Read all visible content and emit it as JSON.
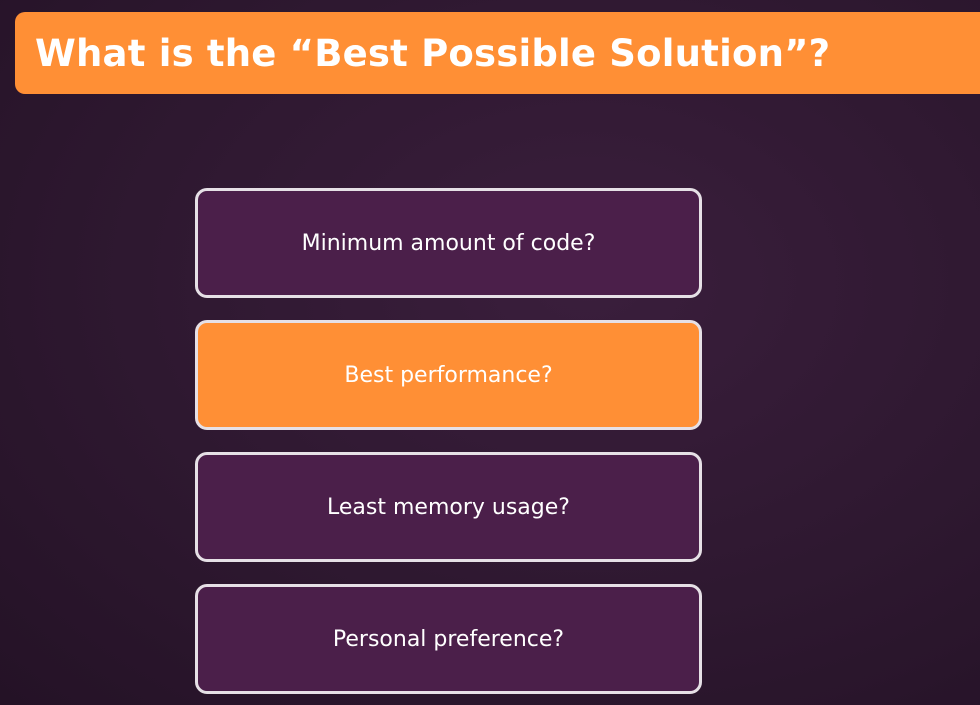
{
  "slide": {
    "title": "What is the “Best Possible Solution”?"
  },
  "options": [
    {
      "label": "Minimum amount of code?",
      "highlighted": false
    },
    {
      "label": "Best performance?",
      "highlighted": true
    },
    {
      "label": "Least memory usage?",
      "highlighted": false
    },
    {
      "label": "Personal preference?",
      "highlighted": false
    }
  ],
  "colors": {
    "accent": "#ff8f35",
    "option_background": "#4b1f4a",
    "page_background": "#2e1830",
    "option_border": "#e6e0e6",
    "text": "#ffffff"
  }
}
